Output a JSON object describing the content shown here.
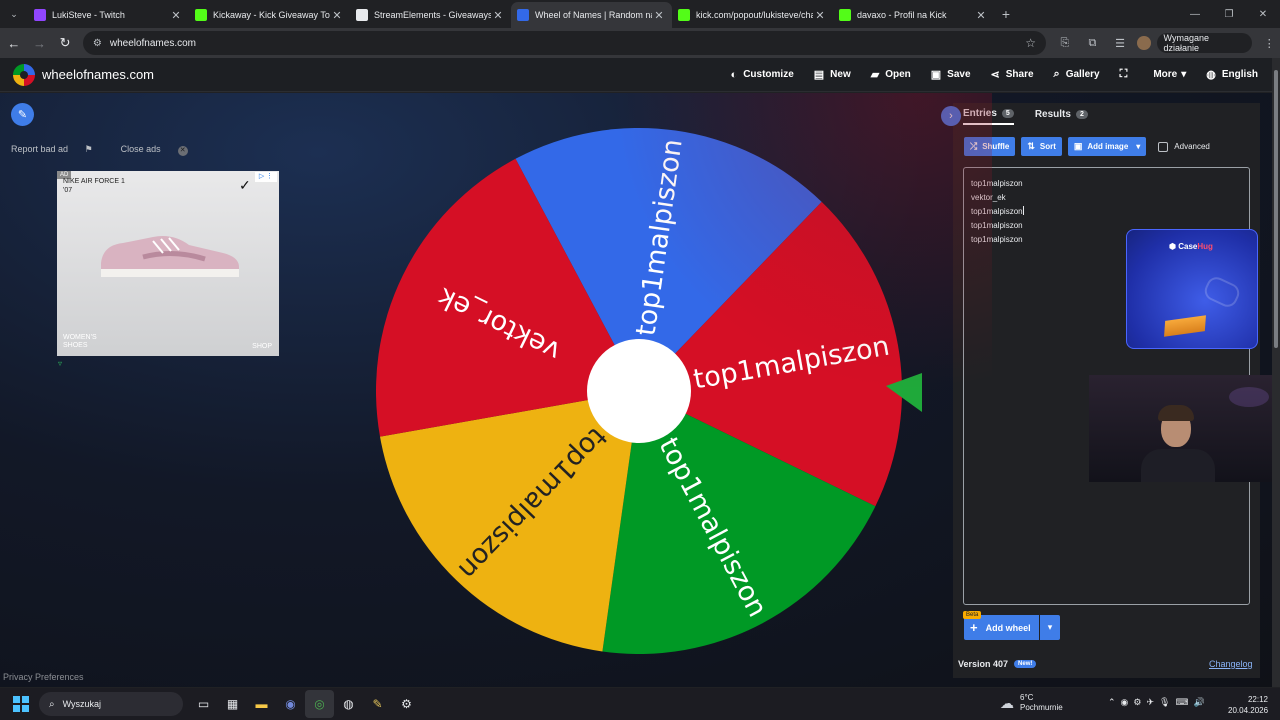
{
  "browser": {
    "tabs": [
      {
        "title": "LukiSteve - Twitch",
        "color": "#9146ff",
        "active": false
      },
      {
        "title": "Kickaway - Kick Giveaway Tool",
        "color": "#53fc18",
        "active": false
      },
      {
        "title": "StreamElements - Giveaways",
        "color": "#e8eaed",
        "active": false
      },
      {
        "title": "Wheel of Names | Random nam",
        "color": "#3369e8",
        "active": true
      },
      {
        "title": "kick.com/popout/lukisteve/chat",
        "color": "#53fc18",
        "active": false
      },
      {
        "title": "davaxo - Profil na Kick",
        "color": "#53fc18",
        "active": false
      }
    ],
    "url": "wheelofnames.com",
    "action_required": "Wymagane działanie"
  },
  "site": {
    "logo": "wheelofnames.com",
    "menu": [
      {
        "label": "Customize",
        "icon": "palette-icon"
      },
      {
        "label": "New",
        "icon": "file-icon"
      },
      {
        "label": "Open",
        "icon": "folder-icon"
      },
      {
        "label": "Save",
        "icon": "save-icon"
      },
      {
        "label": "Share",
        "icon": "share-icon"
      },
      {
        "label": "Gallery",
        "icon": "search-icon"
      },
      {
        "label": "",
        "icon": "fullscreen-icon"
      },
      {
        "label": "More",
        "icon": "chevron-down-icon"
      },
      {
        "label": "English",
        "icon": "globe-icon"
      }
    ]
  },
  "ads": {
    "report": "Report bad ad",
    "close": "Close ads",
    "badge": "AD",
    "title": "NIKE AIR FORCE 1 '07",
    "caption_line1": "WOMEN'S",
    "caption_line2": "SHOES",
    "shop": "SHOP"
  },
  "privacy": "Privacy Preferences",
  "wheel": {
    "segments": [
      {
        "label": "top1malpiszon",
        "color": "#3369e8"
      },
      {
        "label": "top1malpiszon",
        "color": "#d50f25"
      },
      {
        "label": "top1malpiszon",
        "color": "#009925"
      },
      {
        "label": "top1malpiszon",
        "color": "#eeb211"
      },
      {
        "label": "vektor_ek",
        "color": "#d50f25"
      }
    ],
    "pointer_color": "#1fa93a"
  },
  "panel": {
    "tabs": [
      {
        "label": "Entries",
        "count": "5"
      },
      {
        "label": "Results",
        "count": "2"
      }
    ],
    "buttons": {
      "shuffle": "Shuffle",
      "sort": "Sort",
      "add_image": "Add image",
      "advanced": "Advanced"
    },
    "entries": [
      "top1malpiszon",
      "vektor_ek",
      "top1malpiszon",
      "top1malpiszon",
      "top1malpiszon"
    ],
    "beta": "Beta",
    "add_wheel": "Add wheel",
    "version": "Version 407",
    "new_badge": "New!",
    "changelog": "Changelog"
  },
  "overlay": {
    "casehug_a": "Case",
    "casehug_b": "Hug"
  },
  "taskbar": {
    "search": "Wyszukaj",
    "weather_temp": "6°C",
    "weather_desc": "Pochmurnie",
    "time": "22:12",
    "date": "20.04.2026"
  }
}
